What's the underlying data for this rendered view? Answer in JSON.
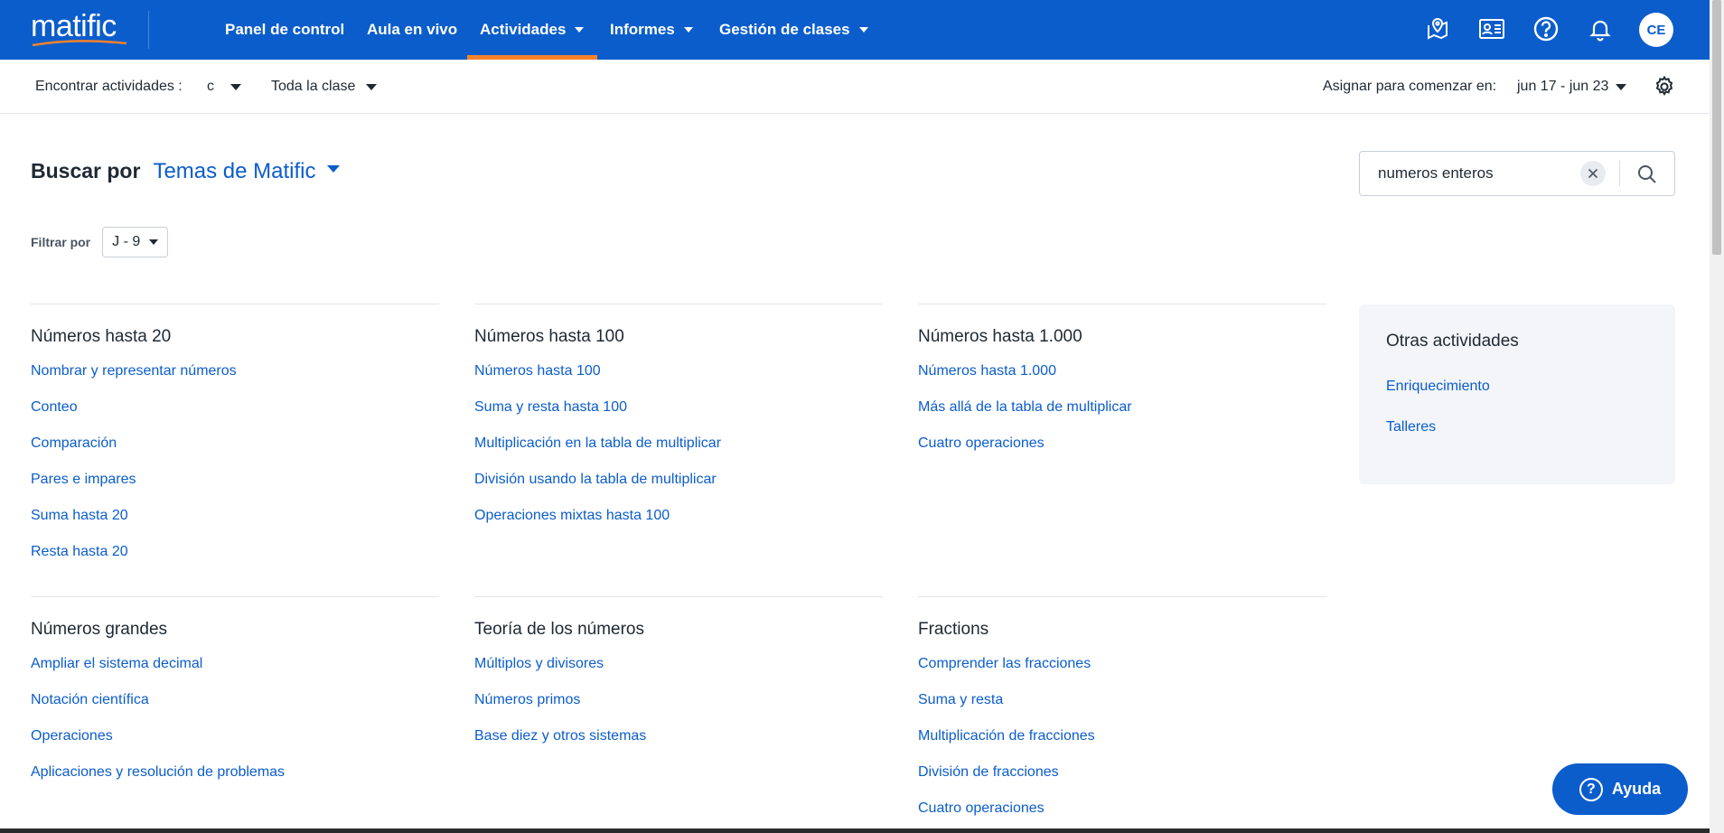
{
  "app": {
    "logo": "matific",
    "colors": {
      "primary": "#0b5dcb",
      "accent": "#f5822a"
    }
  },
  "nav": {
    "items": [
      {
        "label": "Panel de control",
        "dropdown": false
      },
      {
        "label": "Aula en vivo",
        "dropdown": false
      },
      {
        "label": "Actividades",
        "dropdown": true,
        "active": true
      },
      {
        "label": "Informes",
        "dropdown": true
      },
      {
        "label": "Gestión de clases",
        "dropdown": true
      }
    ],
    "icons": [
      "map-pin-icon",
      "id-card-icon",
      "help-circle-icon",
      "bell-icon"
    ],
    "avatar": "CE"
  },
  "subbar": {
    "find_label": "Encontrar actividades :",
    "class_value": "c",
    "group_value": "Toda la clase",
    "assign_label": "Asignar para comenzar en:",
    "date_range": "jun 17 - jun 23"
  },
  "search": {
    "by_label": "Buscar por",
    "topic_source": "Temas de Matific",
    "query": "numeros enteros",
    "filter_label": "Filtrar por",
    "grade_range": "J - 9"
  },
  "topics": [
    {
      "title": "Números hasta 20",
      "links": [
        "Nombrar y representar números",
        "Conteo",
        "Comparación",
        "Pares e impares",
        "Suma hasta 20",
        "Resta hasta 20"
      ]
    },
    {
      "title": "Números hasta 100",
      "links": [
        "Números hasta 100",
        "Suma y resta hasta 100",
        "Multiplicación en la tabla de multiplicar",
        "División usando la tabla de multiplicar",
        "Operaciones mixtas hasta 100"
      ]
    },
    {
      "title": "Números hasta 1.000",
      "links": [
        "Números hasta 1.000",
        "Más allá de la tabla de multiplicar",
        "Cuatro operaciones"
      ]
    },
    {
      "title": "Números grandes",
      "links": [
        "Ampliar el sistema decimal",
        "Notación científica",
        "Operaciones",
        "Aplicaciones y resolución de problemas"
      ]
    },
    {
      "title": "Teoría de los números",
      "links": [
        "Múltiplos y divisores",
        "Números primos",
        "Base diez y otros sistemas"
      ]
    },
    {
      "title": "Fractions",
      "links": [
        "Comprender las fracciones",
        "Suma y resta",
        "Multiplicación de fracciones",
        "División de fracciones",
        "Cuatro operaciones"
      ]
    }
  ],
  "others": {
    "title": "Otras actividades",
    "links": [
      "Enriquecimiento",
      "Talleres"
    ]
  },
  "help": {
    "label": "Ayuda"
  }
}
